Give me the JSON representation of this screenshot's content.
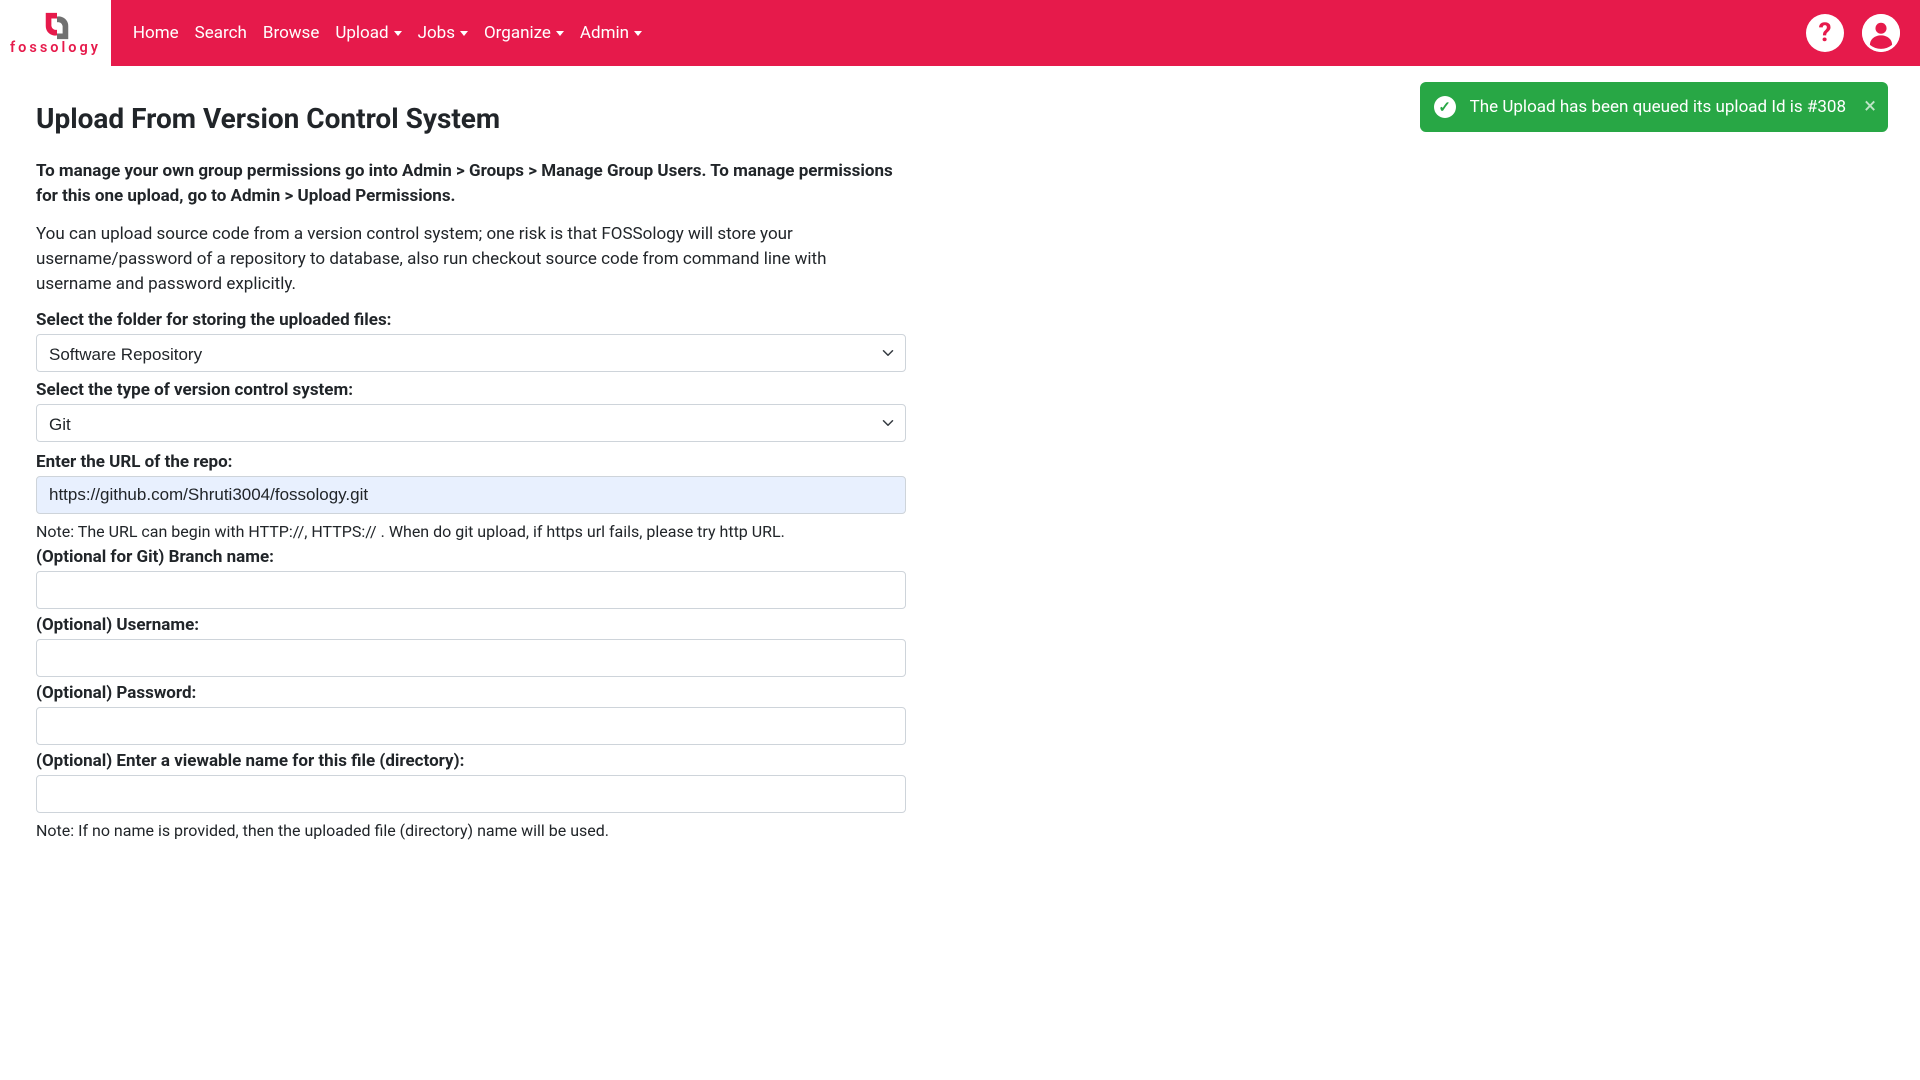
{
  "nav": {
    "brand_text": "fossology",
    "items": [
      {
        "label": "Home",
        "has_caret": false
      },
      {
        "label": "Search",
        "has_caret": false
      },
      {
        "label": "Browse",
        "has_caret": false
      },
      {
        "label": "Upload",
        "has_caret": true
      },
      {
        "label": "Jobs",
        "has_caret": true
      },
      {
        "label": "Organize",
        "has_caret": true
      },
      {
        "label": "Admin",
        "has_caret": true
      }
    ]
  },
  "toast": {
    "message": "The Upload has been queued its upload Id is #308"
  },
  "page": {
    "title": "Upload From Version Control System",
    "intro_bold": "To manage your own group permissions go into Admin > Groups > Manage Group Users. To manage permissions for this one upload, go to Admin > Upload Permissions.",
    "intro": "You can upload source code from a version control system; one risk is that FOSSology will store your username/password of a repository to database, also run checkout source code from command line with username and password explicitly."
  },
  "form": {
    "folder_label": "Select the folder for storing the uploaded files:",
    "folder_value": "Software Repository",
    "vcs_label": "Select the type of version control system:",
    "vcs_value": "Git",
    "url_label": "Enter the URL of the repo:",
    "url_value": "https://github.com/Shruti3004/fossology.git",
    "url_note": "Note: The URL can begin with HTTP://, HTTPS:// . When do git upload, if https url fails, please try http URL.",
    "branch_label": "(Optional for Git) Branch name:",
    "branch_value": "",
    "username_label": "(Optional) Username:",
    "username_value": "",
    "password_label": "(Optional) Password:",
    "password_value": "",
    "viewname_label": "(Optional) Enter a viewable name for this file (directory):",
    "viewname_value": "",
    "viewname_note": "Note: If no name is provided, then the uploaded file (directory) name will be used."
  }
}
